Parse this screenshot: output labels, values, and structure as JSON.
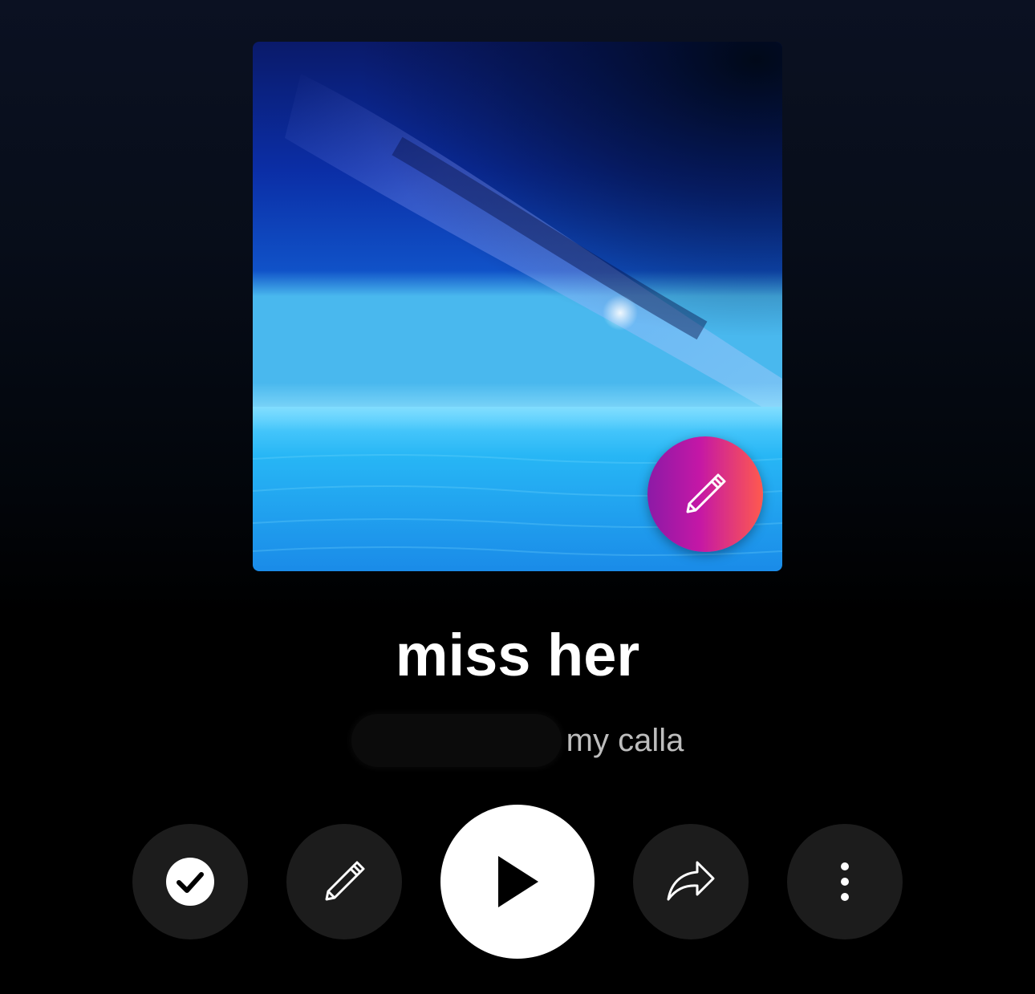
{
  "track": {
    "title": "miss her",
    "subtitle": "my calla"
  },
  "colors": {
    "background": "#000000",
    "control_bg": "#1c1c1c",
    "play_bg": "#ffffff",
    "subtitle": "#bdbdbd",
    "fab_gradient": [
      "#8c1aa6",
      "#c417a6",
      "#ff5a4e"
    ]
  },
  "icons": {
    "artwork_edit": "pencil-icon",
    "check": "check-circle-icon",
    "edit": "pencil-icon",
    "play": "play-icon",
    "share": "share-arrow-icon",
    "more": "more-vertical-icon"
  }
}
